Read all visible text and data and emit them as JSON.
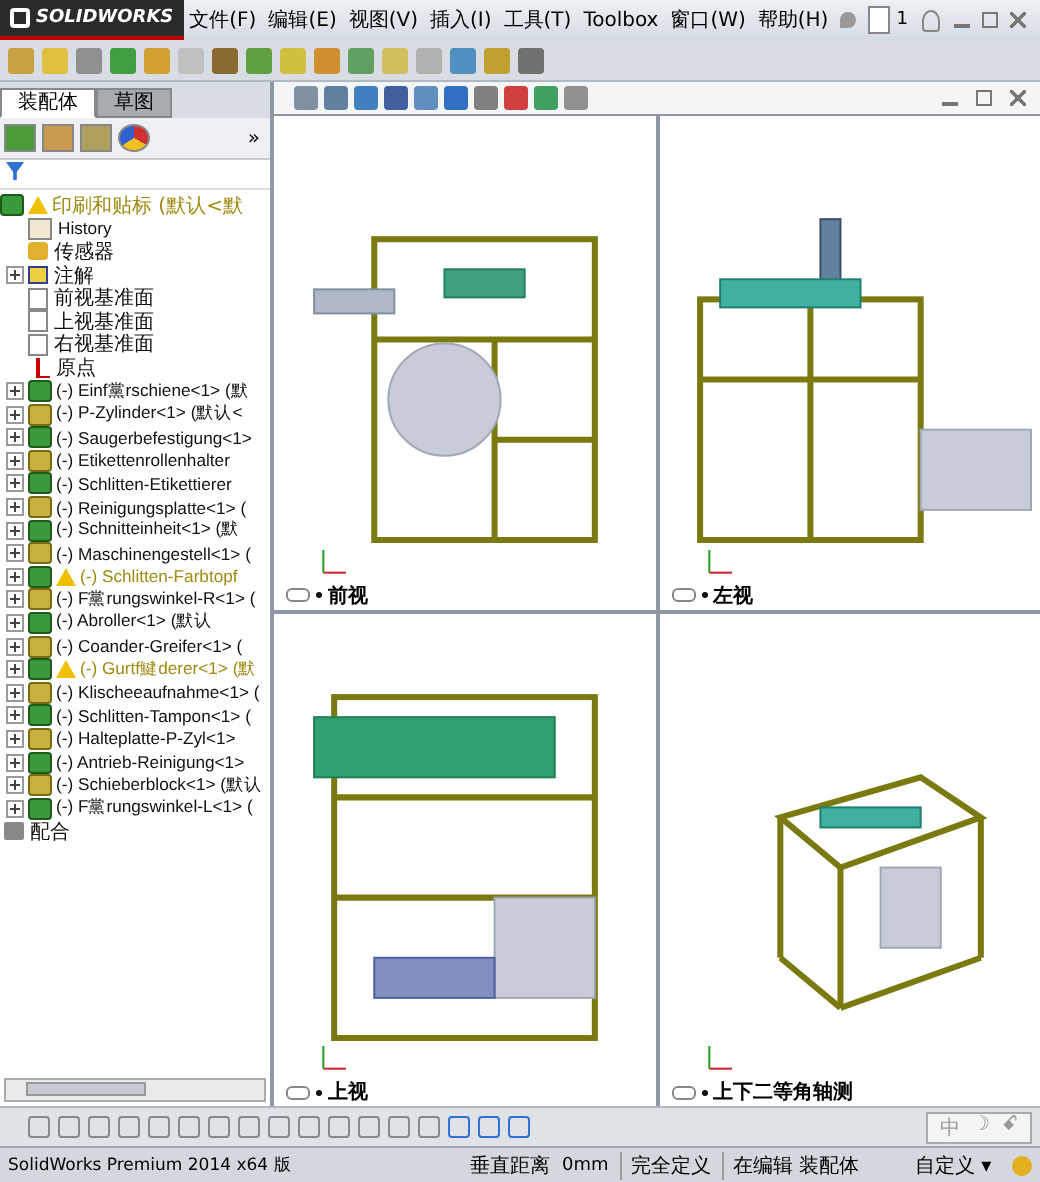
{
  "app": {
    "logo": "SOLIDWORKS",
    "menu": [
      "文件(F)",
      "编辑(E)",
      "视图(V)",
      "插入(I)",
      "工具(T)",
      "Toolbox",
      "窗口(W)",
      "帮助(H)"
    ],
    "page_number": "1"
  },
  "panel": {
    "tabs": [
      {
        "label": "装配体",
        "selected": true
      },
      {
        "label": "草图",
        "selected": false
      }
    ],
    "more": "»",
    "root": {
      "label": "印刷和贴标 (默认<默",
      "warning": true
    },
    "fixed_items": [
      {
        "kind": "history",
        "label": "History"
      },
      {
        "kind": "sensor",
        "label": "传感器"
      },
      {
        "kind": "annotation",
        "label": "注解",
        "expandable": true
      },
      {
        "kind": "plane",
        "label": "前视基准面"
      },
      {
        "kind": "plane",
        "label": "上视基准面"
      },
      {
        "kind": "plane",
        "label": "右视基准面"
      },
      {
        "kind": "origin",
        "label": "原点"
      }
    ],
    "components": [
      {
        "label": "(-) Einf黨rschiene<1> (默",
        "warning": false
      },
      {
        "label": "(-) P-Zylinder<1> (默认<",
        "warning": false
      },
      {
        "label": "(-) Saugerbefestigung<1>",
        "warning": false
      },
      {
        "label": "(-) Etikettenrollenhalter",
        "warning": false
      },
      {
        "label": "(-) Schlitten-Etikettierer",
        "warning": false
      },
      {
        "label": "(-) Reinigungsplatte<1> (",
        "warning": false
      },
      {
        "label": "(-) Schnitteinheit<1> (默",
        "warning": false
      },
      {
        "label": "(-) Maschinengestell<1> (",
        "warning": false
      },
      {
        "label": "(-) Schlitten-Farbtopf",
        "warning": true
      },
      {
        "label": "(-) F黨rungswinkel-R<1> (",
        "warning": false
      },
      {
        "label": "(-) Abroller<1> (默认",
        "warning": false
      },
      {
        "label": "(-) Coander-Greifer<1> (",
        "warning": false
      },
      {
        "label": "(-) Gurtf鰎derer<1> (默",
        "warning": true
      },
      {
        "label": "(-) Klischeeaufnahme<1> (",
        "warning": false
      },
      {
        "label": "(-) Schlitten-Tampon<1> (",
        "warning": false
      },
      {
        "label": "(-) Halteplatte-P-Zyl<1>",
        "warning": false
      },
      {
        "label": "(-) Antrieb-Reinigung<1>",
        "warning": false
      },
      {
        "label": "(-) Schieberblock<1> (默认",
        "warning": false
      },
      {
        "label": "(-) F黨rungswinkel-L<1> (",
        "warning": false
      }
    ],
    "mates": "配合"
  },
  "views": [
    {
      "label": "前视",
      "kind": "front"
    },
    {
      "label": "左视",
      "kind": "left"
    },
    {
      "label": "上视",
      "kind": "top"
    },
    {
      "label": "上下二等角轴测",
      "kind": "iso"
    }
  ],
  "ime": [
    "中",
    "☽",
    "ꗃ"
  ],
  "status_bar": {
    "product": "SolidWorks Premium 2014 x64 版",
    "measure_label": "垂直距离",
    "measure_value": "0mm",
    "state": "完全定义",
    "editing": "在编辑 装配体",
    "units": "自定义",
    "units_caret": "▾"
  }
}
